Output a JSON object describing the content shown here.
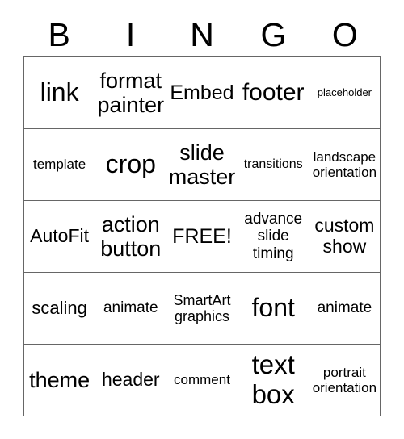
{
  "card": {
    "title_letters": [
      "B",
      "I",
      "N",
      "G",
      "O"
    ],
    "free_space_label": "FREE!",
    "border_color": "#666666",
    "text_color": "#000000",
    "background_color": "#ffffff",
    "columns": 5,
    "rows": 5,
    "cells": [
      [
        {
          "text": "link",
          "size": "fs-3xl"
        },
        {
          "text": "format painter",
          "size": "fs-xl2"
        },
        {
          "text": "Embed",
          "size": "fs-xl"
        },
        {
          "text": "footer",
          "size": "fs-2xl"
        },
        {
          "text": "placeholder",
          "size": "fs-xs"
        }
      ],
      [
        {
          "text": "template",
          "size": "fs-sm2"
        },
        {
          "text": "crop",
          "size": "fs-3xl"
        },
        {
          "text": "slide master",
          "size": "fs-xl2"
        },
        {
          "text": "transitions",
          "size": "fs-sm"
        },
        {
          "text": "landscape orientation",
          "size": "fs-sm2"
        }
      ],
      [
        {
          "text": "AutoFit",
          "size": "fs-lg2"
        },
        {
          "text": "action button",
          "size": "fs-xl2"
        },
        {
          "text": "FREE!",
          "size": "fs-xl"
        },
        {
          "text": "advance slide timing",
          "size": "fs-md2"
        },
        {
          "text": "custom show",
          "size": "fs-lg2"
        }
      ],
      [
        {
          "text": "scaling",
          "size": "fs-lg"
        },
        {
          "text": "animate",
          "size": "fs-md2"
        },
        {
          "text": "SmartArt graphics",
          "size": "fs-md"
        },
        {
          "text": "font",
          "size": "fs-3xl"
        },
        {
          "text": "animate",
          "size": "fs-md2"
        }
      ],
      [
        {
          "text": "theme",
          "size": "fs-xl2"
        },
        {
          "text": "header",
          "size": "fs-lg2"
        },
        {
          "text": "comment",
          "size": "fs-sm2"
        },
        {
          "text": "text box",
          "size": "fs-4xl"
        },
        {
          "text": "portrait orientation",
          "size": "fs-sm2"
        }
      ]
    ]
  }
}
